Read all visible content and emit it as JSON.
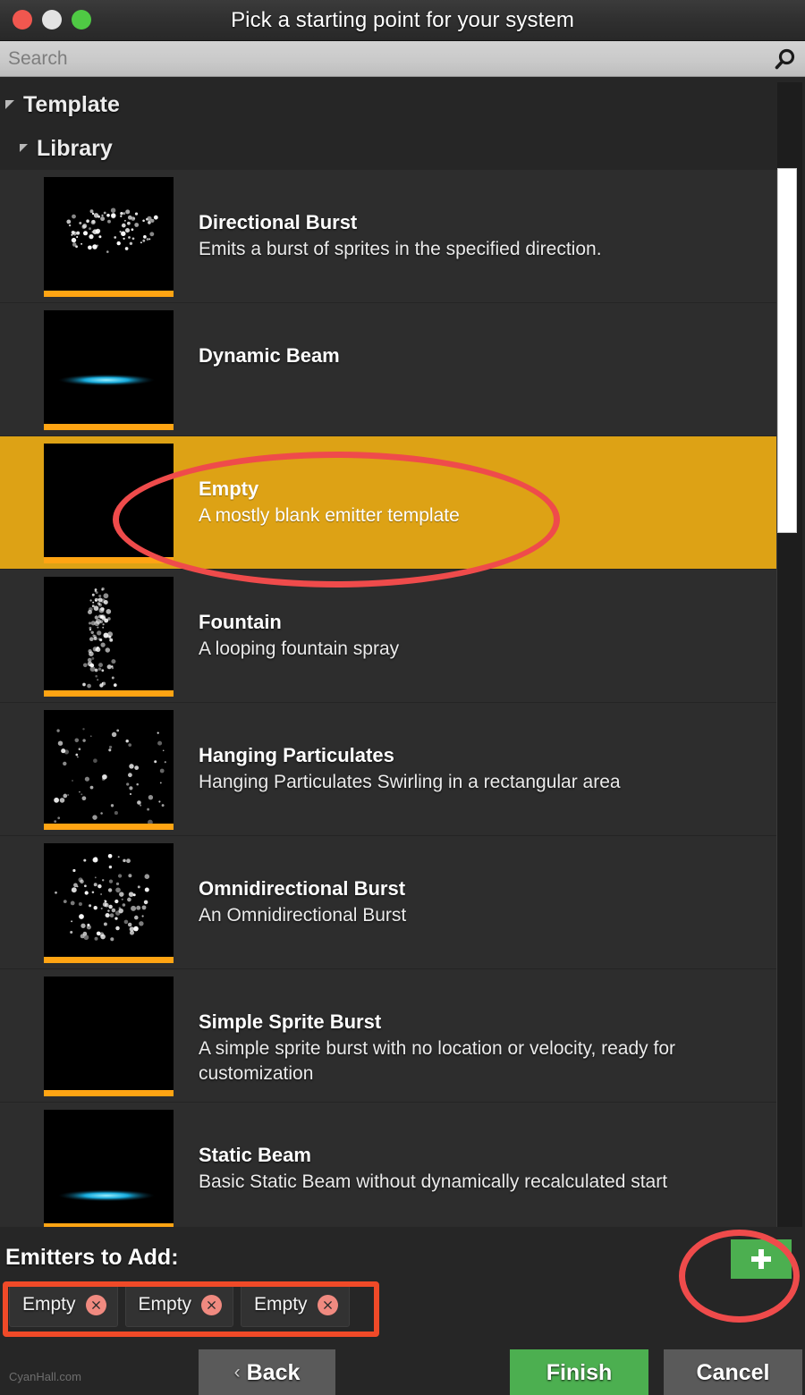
{
  "window": {
    "title": "Pick a starting point for your system",
    "traffic_lights": [
      {
        "name": "close",
        "color": "#f0574f"
      },
      {
        "name": "minimize",
        "color": "#e3e3e3"
      },
      {
        "name": "maximize",
        "color": "#4fca44"
      }
    ]
  },
  "search": {
    "value": "",
    "placeholder": "Search",
    "icon": "search-icon"
  },
  "tree": {
    "root_label": "Template",
    "child_label": "Library"
  },
  "templates": [
    {
      "title": "Directional Burst",
      "description": "Emits a burst of sprites in the specified direction.",
      "selected": false,
      "thumbnail": "directional-burst-preview",
      "accent_color": "#ffa413"
    },
    {
      "title": "Dynamic Beam",
      "description": "",
      "selected": false,
      "thumbnail": "dynamic-beam-preview",
      "accent_color": "#ffa413"
    },
    {
      "title": "Empty",
      "description": "A mostly blank emitter template",
      "selected": true,
      "thumbnail": "empty-preview",
      "accent_color": "#ffa413"
    },
    {
      "title": "Fountain",
      "description": "A looping fountain spray",
      "selected": false,
      "thumbnail": "fountain-preview",
      "accent_color": "#ffa413"
    },
    {
      "title": "Hanging Particulates",
      "description": "Hanging Particulates Swirling in a rectangular area",
      "selected": false,
      "thumbnail": "hanging-particulates-preview",
      "accent_color": "#ffa413"
    },
    {
      "title": "Omnidirectional Burst",
      "description": "An Omnidirectional Burst",
      "selected": false,
      "thumbnail": "omnidirectional-burst-preview",
      "accent_color": "#ffa413"
    },
    {
      "title": "Simple Sprite Burst",
      "description": "A simple sprite burst with no location or velocity, ready for customization",
      "selected": false,
      "thumbnail": "simple-sprite-burst-preview",
      "accent_color": "#ffa413"
    },
    {
      "title": "Static Beam",
      "description": "Basic Static Beam without dynamically recalculated start",
      "selected": false,
      "thumbnail": "static-beam-preview",
      "accent_color": "#ffa413"
    }
  ],
  "footer": {
    "emitters_label": "Emitters to Add:",
    "chips": [
      {
        "label": "Empty",
        "remove_icon": "close-circle-icon"
      },
      {
        "label": "Empty",
        "remove_icon": "close-circle-icon"
      },
      {
        "label": "Empty",
        "remove_icon": "close-circle-icon"
      }
    ],
    "add_button": {
      "icon": "plus-icon",
      "color": "#4caf50"
    },
    "back_label": "Back",
    "back_chevron": "‹",
    "finish_label": "Finish",
    "cancel_label": "Cancel"
  },
  "watermark": "CyanHall.com",
  "colors": {
    "selected_row": "#dda215",
    "accent_bar": "#ffa413",
    "primary_green": "#4caf50",
    "annotation_red": "#ef4b4b",
    "annotation_orange": "#f04a28",
    "panel_background": "#2d2d2d"
  },
  "annotations": [
    {
      "name": "highlight-empty-row",
      "shape": "ellipse",
      "color": "#ef4b4b"
    },
    {
      "name": "highlight-add-button",
      "shape": "circle",
      "color": "#ef4b4b"
    },
    {
      "name": "highlight-chips",
      "shape": "rect",
      "color": "#f04a28"
    }
  ]
}
